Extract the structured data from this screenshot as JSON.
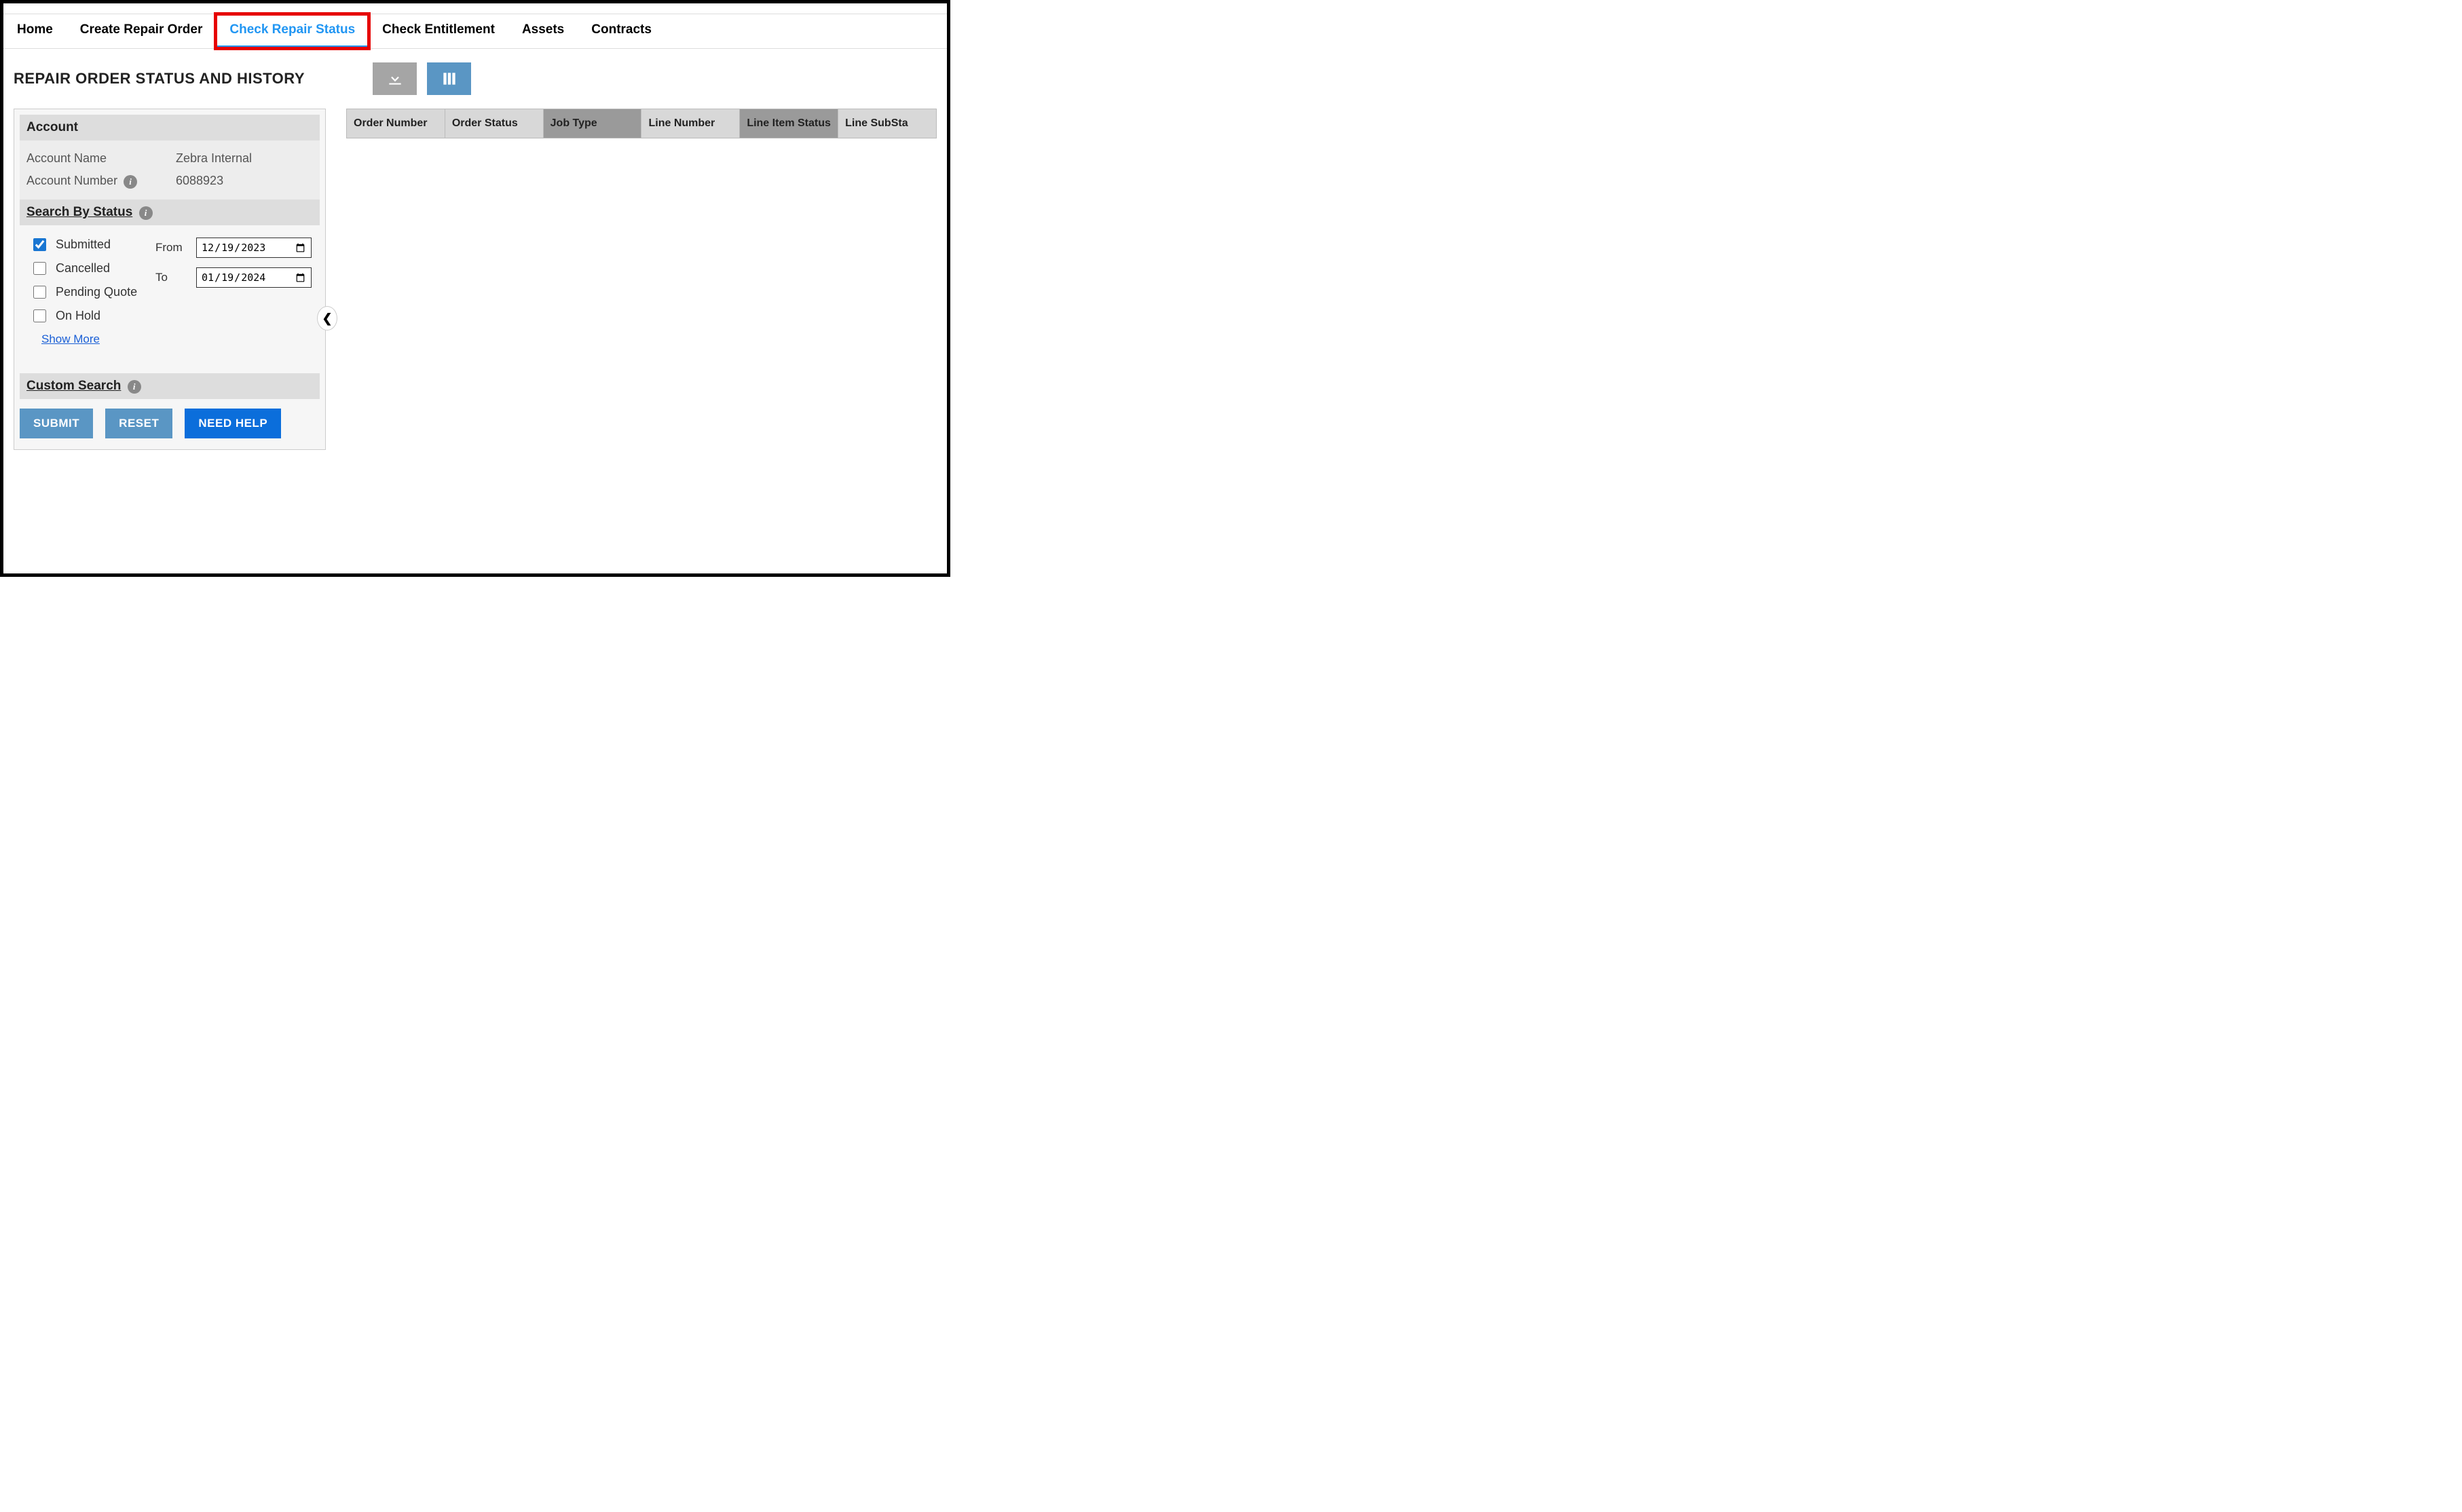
{
  "nav": {
    "tabs": [
      {
        "label": "Home",
        "active": false
      },
      {
        "label": "Create Repair Order",
        "active": false
      },
      {
        "label": "Check Repair Status",
        "active": true,
        "highlighted": true
      },
      {
        "label": "Check Entitlement",
        "active": false
      },
      {
        "label": "Assets",
        "active": false
      },
      {
        "label": "Contracts",
        "active": false
      }
    ]
  },
  "page": {
    "title": "REPAIR ORDER STATUS AND HISTORY"
  },
  "toolbar": {
    "download_title": "Download",
    "columns_title": "Columns"
  },
  "sidebar": {
    "account": {
      "header": "Account",
      "name_label": "Account Name",
      "name_value": "Zebra Internal",
      "number_label": "Account Number",
      "number_value": "6088923"
    },
    "search_by_status": {
      "header": "Search By Status",
      "options": [
        {
          "label": "Submitted",
          "checked": true
        },
        {
          "label": "Cancelled",
          "checked": false
        },
        {
          "label": "Pending Quote",
          "checked": false
        },
        {
          "label": "On Hold",
          "checked": false
        }
      ],
      "from_label": "From",
      "to_label": "To",
      "from_value": "2023-12-19",
      "from_display": "12/19/2023",
      "to_value": "2024-01-19",
      "to_display": "01/19/2024",
      "show_more": "Show More"
    },
    "custom_search": {
      "header": "Custom Search"
    },
    "buttons": {
      "submit": "SUBMIT",
      "reset": "RESET",
      "need_help": "NEED HELP"
    }
  },
  "table": {
    "columns": [
      {
        "label": "Order Number",
        "sorted": false
      },
      {
        "label": "Order Status",
        "sorted": false
      },
      {
        "label": "Job Type",
        "sorted": true
      },
      {
        "label": "Line Number",
        "sorted": false
      },
      {
        "label": "Line Item Status",
        "sorted": true
      },
      {
        "label": "Line SubSta",
        "sorted": false
      }
    ]
  }
}
